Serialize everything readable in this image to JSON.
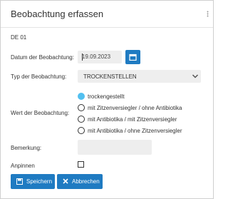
{
  "dialog": {
    "title": "Beobachtung erfassen"
  },
  "section": {
    "code": "DE 01"
  },
  "date": {
    "label": "Datum der Beobachtung:",
    "value": "19.09.2023"
  },
  "type": {
    "label": "Typ der Beobachtung:",
    "selected": "TROCKENSTELLEN"
  },
  "value": {
    "label": "Wert der Beobachtung:",
    "options": [
      "trockengestellt",
      "mit Zitzenversiegler / ohne Antibiotika",
      "mit Antibiotika / mit Zitzenversiegler",
      "mit Antibiotika / ohne Zitzenversiegler"
    ],
    "selected_index": 0
  },
  "remark": {
    "label": "Bemerkung:",
    "value": ""
  },
  "pin": {
    "label": "Anpinnen",
    "checked": false
  },
  "buttons": {
    "save": "Speichern",
    "cancel": "Abbrechen"
  },
  "colors": {
    "accent": "#1f7bc2",
    "radio_selected": "#52c0f0",
    "field_bg": "#eeeeee"
  },
  "icons": {
    "calendar": "calendar-icon",
    "dropdown": "chevron-down-icon",
    "save": "floppy-disk-icon",
    "cancel": "close-icon"
  }
}
